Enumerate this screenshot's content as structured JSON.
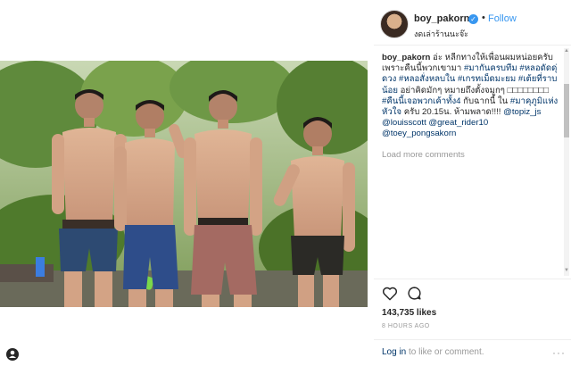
{
  "post": {
    "username": "boy_pakorn",
    "verified_icon": "verified-badge-icon",
    "separator": "•",
    "follow_label": "Follow",
    "location": "งดเล่าร้านนะจ๊ะ"
  },
  "caption": {
    "username": "boy_pakorn",
    "text_1": " อ่ะ หลีกทางให้เพื่อนผมหน่อยครับ เพราะคืนนี้พวกเขามา ",
    "tag_1": "#มากันครบทีม",
    "text_2": " ",
    "tag_2": "#หลอดัดดุ่ดวง",
    "text_3": " ",
    "tag_3": "#หลอสั่งหลบใน",
    "text_4": " ",
    "tag_4": "#เกรทเม็ดมะยม",
    "text_5": " ",
    "tag_5": "#เต้ยที่ราบน้อย",
    "text_6": " อย่าคิดมักๆ หมายถึงตั้งจมูกๆ □□□□□□□□ ",
    "tag_6": "#คืนนี้เจอพวกเค้าทั้ง4",
    "text_7": " กับฉากนี้ ใน ",
    "tag_7": "#มาคุภูมิแห่งหัวใจ",
    "text_8": " ครับ 20.15น. ห้ามพลาด!!!! ",
    "mention_1": "@topiz_js",
    "text_9": " ",
    "mention_2": "@louisscott",
    "text_10": " ",
    "mention_3": "@great_rider10",
    "text_11": " ",
    "mention_4": "@toey_pongsakorn"
  },
  "load_more": "Load more comments",
  "likes": "143,735 likes",
  "time_ago": "8 HOURS AGO",
  "login": {
    "link": "Log in",
    "rest": " to like or comment."
  },
  "more_options": "···",
  "icons": {
    "like": "heart-icon",
    "comment": "comment-bubble-icon",
    "tag": "user-tag-icon",
    "more": "more-options-icon"
  },
  "colors": {
    "link_blue": "#3897f0",
    "hashtag": "#003569",
    "muted": "#999999",
    "text": "#262626"
  }
}
